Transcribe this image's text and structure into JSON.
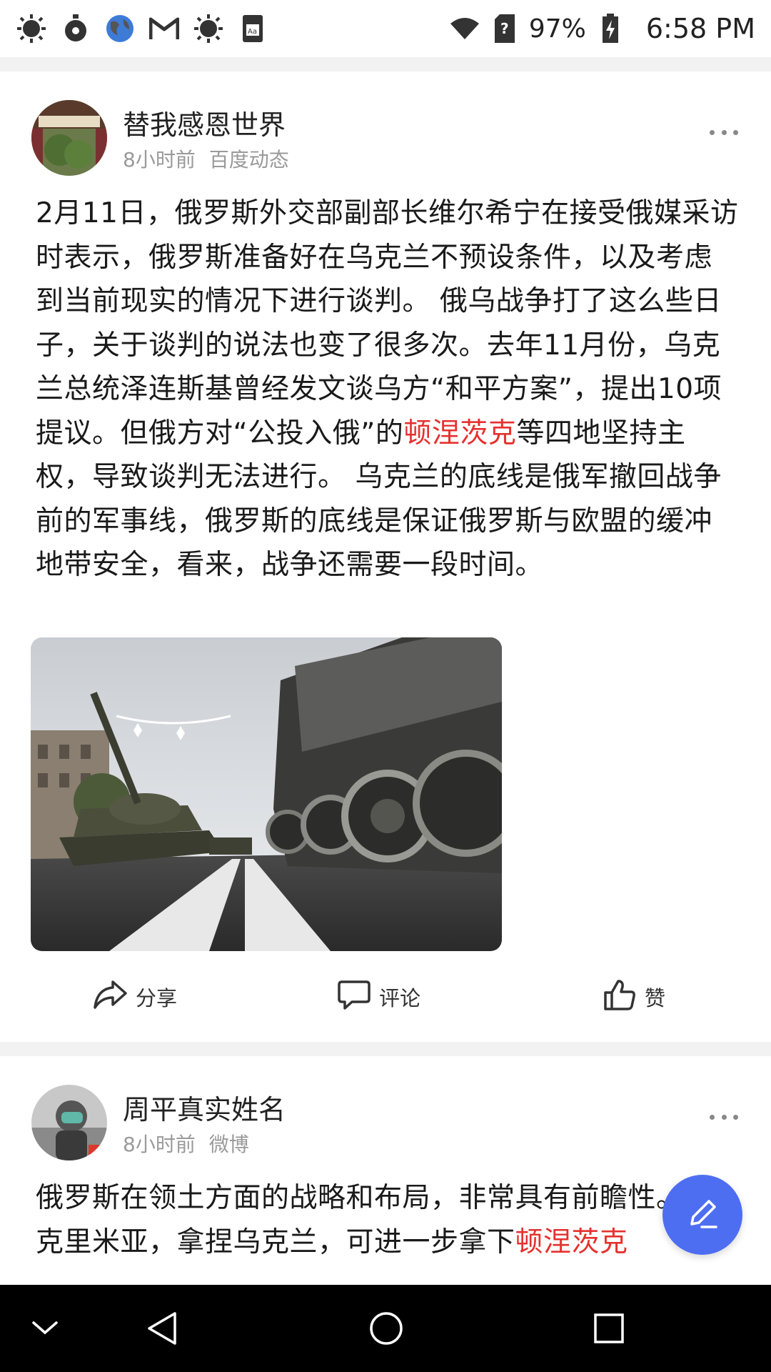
{
  "status_bar": {
    "battery_percent": "97%",
    "time": "6:58 PM",
    "left_icons": [
      "sun-icon",
      "timer-icon",
      "globe-icon",
      "gmail-icon",
      "sun-icon",
      "reader-icon"
    ],
    "right_icons": [
      "wifi-icon",
      "unknown-sim-icon",
      "battery-charging-icon"
    ]
  },
  "posts": [
    {
      "author": "替我感恩世界",
      "time": "8小时前",
      "source": "百度动态",
      "text_before_link": "2月11日，俄罗斯外交部副部长维尔希宁在接受俄媒采访时表示，俄罗斯准备好在乌克兰不预设条件，以及考虑到当前现实的情况下进行谈判。 俄乌战争打了这么些日子，关于谈判的说法也变了很多次。去年11月份，乌克兰总统泽连斯基曾经发文谈乌方“和平方案”，提出10项提议。但俄方对“公投入俄”的",
      "link": "顿涅茨克",
      "text_after_link": "等四地坚持主权，导致谈判无法进行。 乌克兰的底线是俄军撤回战争前的军事线，俄罗斯的底线是保证俄罗斯与欧盟的缓冲地带安全，看来，战争还需要一段时间。",
      "actions": {
        "share": "分享",
        "comment": "评论",
        "like": "赞"
      }
    },
    {
      "author": "周平真实姓名",
      "time": "8小时前",
      "source": "微博",
      "text_before_link": "俄罗斯在领土方面的战略和布局，非常具有前瞻性。\n克里米亚，拿捏乌克兰，可进一步拿下",
      "link": "顿涅茨克"
    }
  ],
  "colors": {
    "link": "#e5312f",
    "fab": "#4e6ef2",
    "meta": "#9a9a9a"
  },
  "nav": [
    "collapse-icon",
    "back-icon",
    "home-icon",
    "recents-icon"
  ]
}
